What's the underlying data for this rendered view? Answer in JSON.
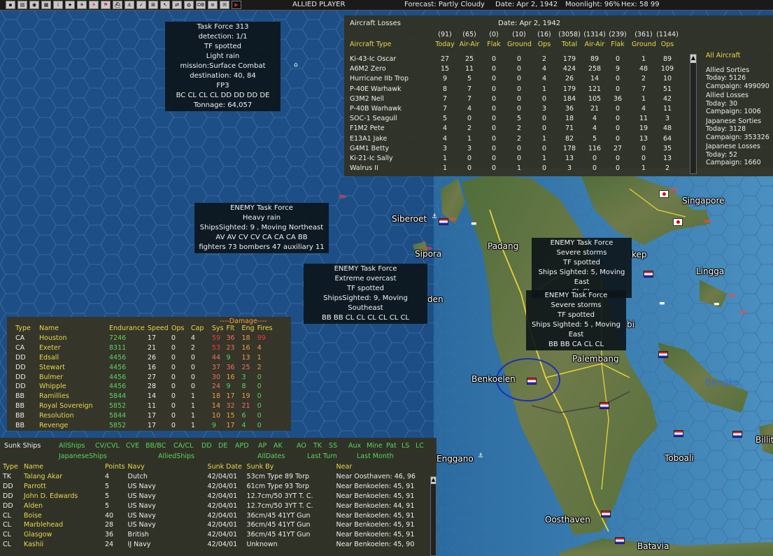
{
  "topbar": {
    "player": "ALLIED PLAYER",
    "forecast": "Forecast: Partly Cloudy",
    "date": "Date: Apr 2, 1942",
    "moonlight": "Moonlight: 96%",
    "hex": "Hex: 58 99"
  },
  "toolbar_icons": [
    "save-icon",
    "file-icon",
    "camera-icon",
    "map-icon",
    "info-icon",
    "star-icon",
    "plane-icon",
    "red-plane-icon",
    "flag-icon",
    "ship-icon",
    "anchor-icon",
    "check-icon",
    "airfield-icon",
    "cursor-icon",
    "arrows-icon",
    "globe-icon",
    "ob-icon",
    "report-icon",
    "mail-icon",
    "end-turn-icon"
  ],
  "tf_boxes": [
    {
      "lines": [
        "Task Force 313",
        "detection: 1/1",
        "TF spotted",
        "Light rain",
        "mission:Surface Combat",
        "destination: 40, 84",
        "FP3",
        "BC CL CL CL DD DD DD DE",
        "Tonnage: 64,057"
      ]
    },
    {
      "lines": [
        "ENEMY Task Force",
        "Heavy rain",
        "ShipsSighted: 9 , Moving Northeast",
        "AV AV CV CV CA CA CA BB",
        "fighters 73  bombers 47  auxiliary 11"
      ]
    },
    {
      "lines": [
        "ENEMY Task Force",
        "Extreme overcast",
        "TF spotted",
        "ShipsSighted: 9, Moving Southeast",
        "BB BB CL CL CL CL CL CL"
      ]
    },
    {
      "lines": [
        "ENEMY Task Force",
        "Severe storms",
        "TF spotted",
        "Ships Sighted: 5, Moving East",
        "CL CL"
      ]
    },
    {
      "lines": [
        "ENEMY Task Force",
        "Severe storms",
        "TF spotted",
        "Ships Sighted: 5 , Moving East",
        "BB BB CA CL CL"
      ]
    }
  ],
  "map_labels": [
    "Siberoet",
    "Sipora",
    "Padang",
    "Singapore",
    "Lingga",
    "Palembang",
    "Bangka",
    "Benkoelen",
    "Enggano",
    "Toboali",
    "Oosthaven",
    "Batavia",
    "Billit",
    "kep",
    "den",
    "bi"
  ],
  "aircraft": {
    "title": "Aircraft Losses",
    "date": "Date: Apr 2, 1942",
    "totals": [
      "(91)",
      "(65)",
      "(0)",
      "(10)",
      "(16)",
      "(3058)",
      "(1314)",
      "(239)",
      "(361)",
      "(1144)"
    ],
    "headers": [
      "Aircraft Type",
      "Today",
      "Air-Air",
      "Flak",
      "Ground",
      "Ops",
      "Total",
      "Air-Air",
      "Flak",
      "Ground",
      "Ops"
    ],
    "rows": [
      [
        "Ki-43-Ic Oscar",
        "27",
        "25",
        "0",
        "0",
        "2",
        "179",
        "89",
        "0",
        "1",
        "89"
      ],
      [
        "A6M2 Zero",
        "15",
        "11",
        "0",
        "0",
        "4",
        "424",
        "258",
        "9",
        "48",
        "109"
      ],
      [
        "Hurricane IIb Trop",
        "9",
        "5",
        "0",
        "0",
        "4",
        "26",
        "14",
        "0",
        "2",
        "10"
      ],
      [
        "P-40E Warhawk",
        "8",
        "7",
        "0",
        "0",
        "1",
        "179",
        "121",
        "0",
        "7",
        "51"
      ],
      [
        "G3M2 Nell",
        "7",
        "7",
        "0",
        "0",
        "0",
        "184",
        "105",
        "36",
        "1",
        "42"
      ],
      [
        "P-40B Warhawk",
        "7",
        "4",
        "0",
        "0",
        "3",
        "36",
        "21",
        "0",
        "4",
        "11"
      ],
      [
        "SOC-1 Seagull",
        "5",
        "0",
        "0",
        "5",
        "0",
        "18",
        "4",
        "0",
        "11",
        "3"
      ],
      [
        "F1M2 Pete",
        "4",
        "2",
        "0",
        "2",
        "0",
        "71",
        "4",
        "0",
        "19",
        "48"
      ],
      [
        "E13A1 Jake",
        "4",
        "1",
        "0",
        "2",
        "1",
        "82",
        "5",
        "0",
        "13",
        "64"
      ],
      [
        "G4M1 Betty",
        "3",
        "3",
        "0",
        "0",
        "0",
        "178",
        "116",
        "27",
        "0",
        "35"
      ],
      [
        "Ki-21-Ic Sally",
        "1",
        "0",
        "0",
        "0",
        "1",
        "13",
        "0",
        "0",
        "0",
        "13"
      ],
      [
        "Walrus II",
        "1",
        "0",
        "0",
        "1",
        "0",
        "3",
        "0",
        "0",
        "1",
        "2"
      ]
    ],
    "side": {
      "all": "All Aircraft",
      "allied_sorties": "Allied Sorties",
      "as_today": "Today:  5126",
      "as_campaign": "Campaign: 499090",
      "allied_losses": "Allied Losses",
      "al_today": "Today:  30",
      "al_campaign": "Campaign: 1006",
      "jap_sorties": "Japanese Sorties",
      "js_today": "Today:  3128",
      "js_campaign": "Campaign: 353326",
      "jap_losses": "Japanese Losses",
      "jl_today": "Today:  52",
      "jl_campaign": "Campaign: 1660"
    }
  },
  "ships": {
    "damage_header": "----Damage----",
    "headers": [
      "Type",
      "Name",
      "Endurance",
      "Speed",
      "Ops",
      "Cap",
      "Sys",
      "Flt",
      "Eng",
      "Fires"
    ],
    "rows": [
      [
        "CA",
        "Houston",
        "7246",
        "17",
        "0",
        "4",
        "59",
        "36",
        "18",
        "99"
      ],
      [
        "CA",
        "Exeter",
        "8311",
        "21",
        "0",
        "2",
        "53",
        "23",
        "16",
        "4"
      ],
      [
        "DD",
        "Edsall",
        "4456",
        "26",
        "0",
        "0",
        "44",
        "9",
        "13",
        "1"
      ],
      [
        "DD",
        "Stewart",
        "4456",
        "16",
        "0",
        "0",
        "37",
        "36",
        "25",
        "2"
      ],
      [
        "DD",
        "Bulmer",
        "4456",
        "27",
        "0",
        "0",
        "30",
        "16",
        "3",
        "0"
      ],
      [
        "DD",
        "Whipple",
        "4456",
        "28",
        "0",
        "0",
        "24",
        "9",
        "8",
        "0"
      ],
      [
        "BB",
        "Ramillies",
        "5844",
        "14",
        "0",
        "1",
        "18",
        "17",
        "19",
        "0"
      ],
      [
        "BB",
        "Royal Sovereign",
        "5852",
        "11",
        "0",
        "1",
        "14",
        "32",
        "21",
        "0"
      ],
      [
        "BB",
        "Resolution",
        "5844",
        "17",
        "0",
        "1",
        "10",
        "15",
        "6",
        "0"
      ],
      [
        "BB",
        "Revenge",
        "5852",
        "17",
        "0",
        "1",
        "9",
        "17",
        "4",
        "0"
      ]
    ]
  },
  "sunk": {
    "title": "Sunk Ships",
    "filters1": [
      "AllShips",
      "CV/CVL",
      "CVE",
      "BB/BC",
      "CA/CL",
      "DD",
      "DE",
      "APD",
      "AP",
      "AK",
      "AO",
      "TK",
      "SS",
      "Aux",
      "Mine",
      "Pat",
      "LS",
      "LC"
    ],
    "filters2": [
      "JapaneseShips",
      "AlliedShips",
      "AllDates",
      "Last Turn",
      "Last Month"
    ],
    "headers": [
      "Type",
      "Name",
      "Points",
      "Navy",
      "Sunk Date",
      "Sunk By",
      "Near"
    ],
    "rows": [
      [
        "TK",
        "Talang Akar",
        "4",
        "Dutch",
        "42/04/01",
        "53cm Type 89 Torp",
        "Near Oosthaven: 46, 96"
      ],
      [
        "DD",
        "Parrott",
        "5",
        "US Navy",
        "42/04/01",
        "61cm Type 93 Torp",
        "Near Benkoelen: 45, 91"
      ],
      [
        "DD",
        "John D. Edwards",
        "5",
        "US Navy",
        "42/04/01",
        "12.7cm/50 3YT T. C.",
        "Near Benkoelen: 45, 91"
      ],
      [
        "DD",
        "Alden",
        "5",
        "US Navy",
        "42/04/01",
        "12.7cm/50 3YT T. C.",
        "Near Benkoelen: 44, 91"
      ],
      [
        "CL",
        "Boise",
        "40",
        "US Navy",
        "42/04/01",
        "36cm/45 41YT Gun",
        "Near Benkoelen: 45, 91"
      ],
      [
        "CL",
        "Marblehead",
        "28",
        "US Navy",
        "42/04/01",
        "36cm/45 41YT Gun",
        "Near Benkoelen: 45, 91"
      ],
      [
        "CL",
        "Glasgow",
        "36",
        "British",
        "42/04/01",
        "36cm/45 41YT Gun",
        "Near Benkoelen: 45, 91"
      ],
      [
        "CL",
        "Kashii",
        "24",
        "IJ Navy",
        "42/04/01",
        "Unknown",
        "Near Benkoelen: 45, 90"
      ]
    ]
  }
}
